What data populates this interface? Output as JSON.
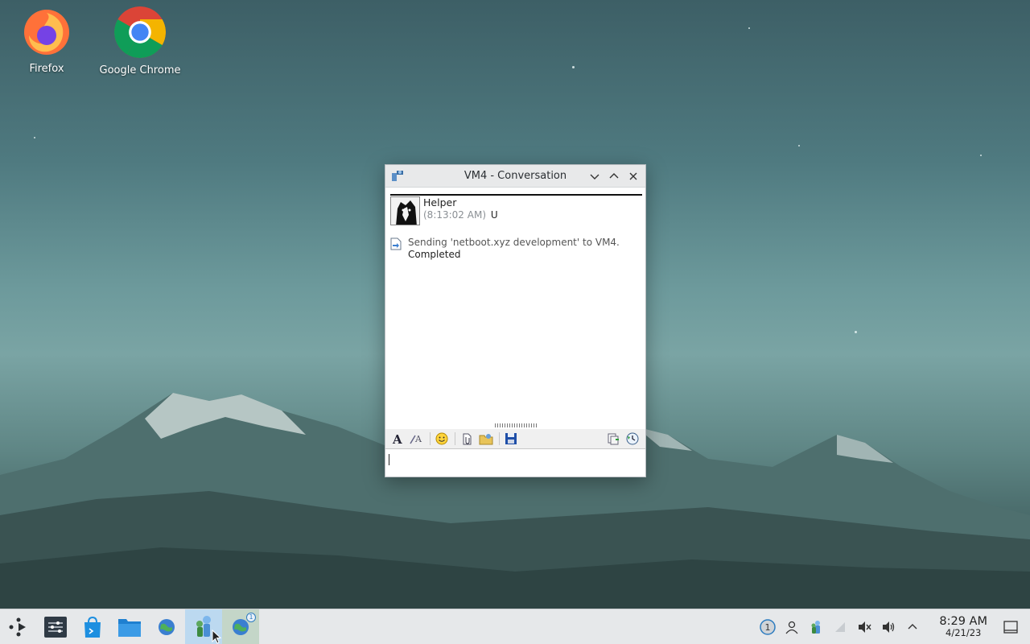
{
  "desktop": {
    "icons": [
      {
        "label": "Firefox"
      },
      {
        "label": "Google Chrome"
      }
    ]
  },
  "window": {
    "title": "VM4 - Conversation",
    "message": {
      "sender": "Helper",
      "time": "(8:13:02 AM)",
      "flag": "U"
    },
    "transfer": {
      "text": "Sending 'netboot.xyz  development' to VM4.",
      "status": "Completed"
    },
    "toolbar": {
      "icons": [
        "font-icon",
        "font-color-icon",
        "smiley-icon",
        "attach-icon",
        "send-file-icon",
        "save-icon",
        "copy-icon",
        "history-icon"
      ]
    },
    "input": {
      "value": ""
    }
  },
  "taskbar": {
    "apps": [
      "app-launcher-icon",
      "settings-icon",
      "discover-icon",
      "file-manager-icon",
      "network-icon",
      "kopete-icon",
      "kopete-grouped-icon"
    ],
    "tray_badge": "1",
    "app_badge": "1",
    "clock": {
      "time": "8:29 AM",
      "date": "4/21/23"
    }
  },
  "colors": {
    "titlebar": "#e8e9ea",
    "taskbar": "#e6e8ea",
    "active_task": "#bcd9f0"
  }
}
